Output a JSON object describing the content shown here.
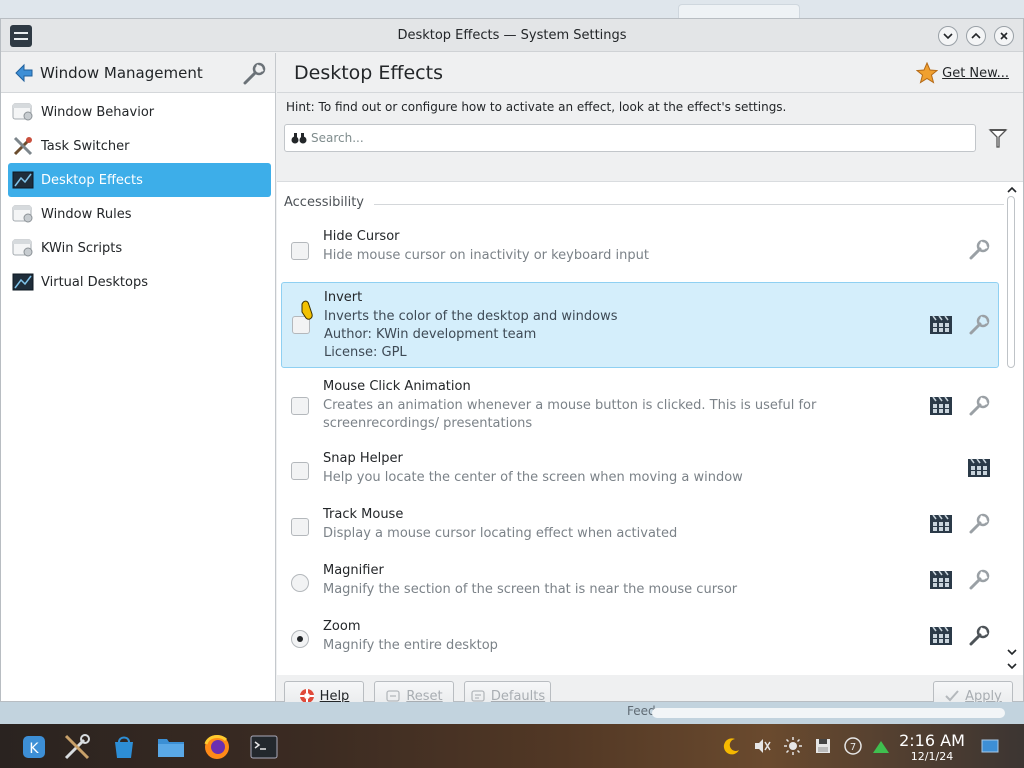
{
  "window": {
    "title": "Desktop Effects — System Settings",
    "controls": [
      "minimize",
      "maximize",
      "close"
    ]
  },
  "sidebar": {
    "title": "Window Management",
    "items": [
      {
        "label": "Window Behavior",
        "icon": "window-behavior-icon",
        "active": false
      },
      {
        "label": "Task Switcher",
        "icon": "task-switcher-icon",
        "active": false
      },
      {
        "label": "Desktop Effects",
        "icon": "desktop-effects-icon",
        "active": true
      },
      {
        "label": "Window Rules",
        "icon": "window-rules-icon",
        "active": false
      },
      {
        "label": "KWin Scripts",
        "icon": "kwin-scripts-icon",
        "active": false
      },
      {
        "label": "Virtual Desktops",
        "icon": "virtual-desktops-icon",
        "active": false
      }
    ]
  },
  "main": {
    "title": "Desktop Effects",
    "get_new_label": "Get New...",
    "hint": "Hint: To find out or configure how to activate an effect, look at the effect's settings.",
    "search_placeholder": "Search...",
    "section": "Accessibility",
    "effects": [
      {
        "name": "Hide Cursor",
        "desc": "Hide mouse cursor on inactivity or keyboard input",
        "control": "checkbox",
        "checked": false,
        "video": false,
        "configure": true
      },
      {
        "name": "Invert",
        "desc": "Inverts the color of the desktop and windows",
        "author": "Author: KWin development team",
        "license": "License: GPL",
        "control": "checkbox",
        "checked": false,
        "video": true,
        "configure": true,
        "selected": true
      },
      {
        "name": "Mouse Click Animation",
        "desc": "Creates an animation whenever a mouse button is clicked. This is useful for screenrecordings/ presentations",
        "control": "checkbox",
        "checked": false,
        "video": true,
        "configure": true
      },
      {
        "name": "Snap Helper",
        "desc": "Help you locate the center of the screen when moving a window",
        "control": "checkbox",
        "checked": false,
        "video": true,
        "configure": false
      },
      {
        "name": "Track Mouse",
        "desc": "Display a mouse cursor locating effect when activated",
        "control": "checkbox",
        "checked": false,
        "video": true,
        "configure": true
      },
      {
        "name": "Magnifier",
        "desc": "Magnify the section of the screen that is near the mouse cursor",
        "control": "radio",
        "checked": false,
        "video": true,
        "configure": true
      },
      {
        "name": "Zoom",
        "desc": "Magnify the entire desktop",
        "control": "radio",
        "checked": true,
        "video": true,
        "configure": true
      }
    ]
  },
  "footer": {
    "help": "Help",
    "reset": "Reset",
    "defaults": "Defaults",
    "apply": "Apply"
  },
  "background": {
    "feed_text": "Feed"
  },
  "taskbar": {
    "items": [
      "application-launcher-icon",
      "system-settings-icon",
      "discover-store-icon",
      "file-manager-icon",
      "firefox-icon",
      "terminal-icon"
    ],
    "tray": [
      "night-color-icon",
      "volume-muted-icon",
      "brightness-icon",
      "disk-icon",
      "updates-icon",
      "network-icon"
    ],
    "time": "2:16 AM",
    "date": "12/1/24"
  },
  "colors": {
    "accent": "#3daee9",
    "selection_bg": "#d4eefb",
    "window_bg": "#eff0f1"
  }
}
